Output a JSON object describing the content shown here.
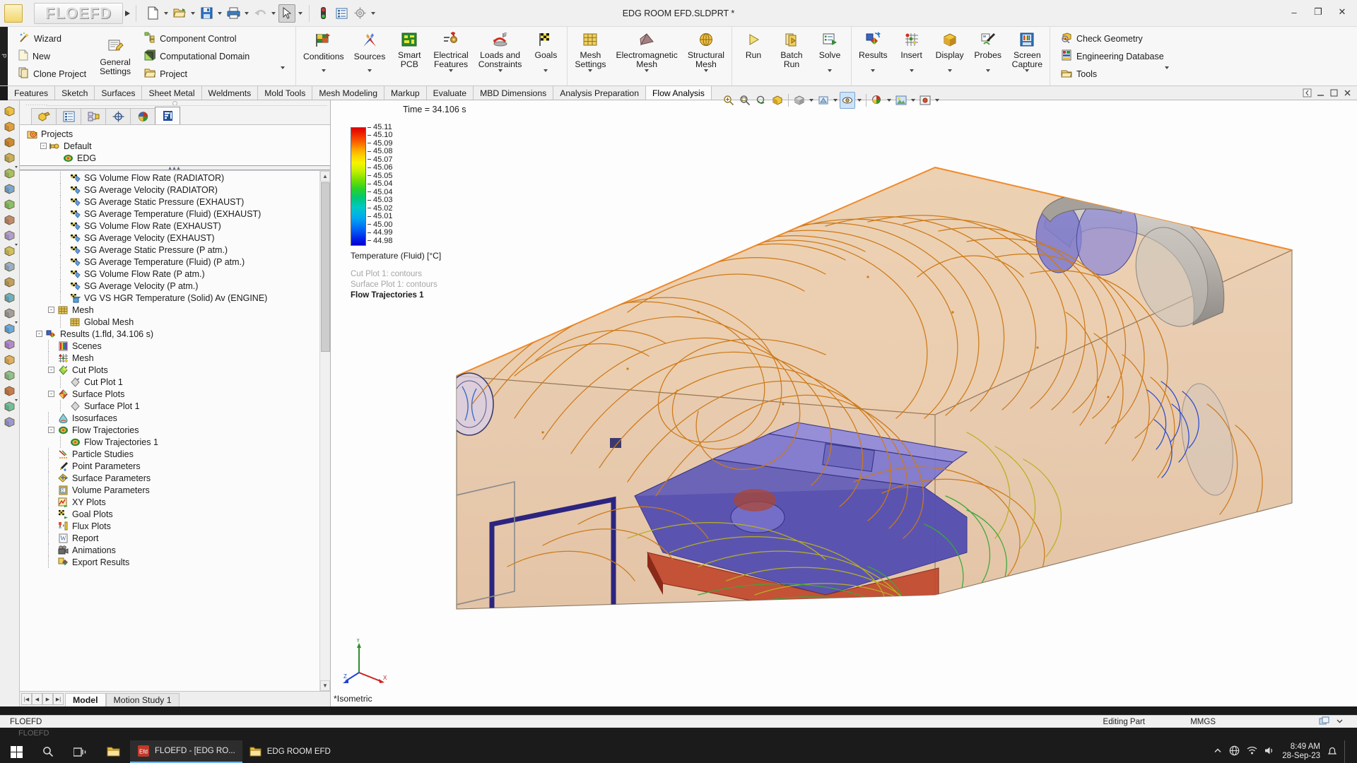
{
  "window": {
    "title": "EDG ROOM EFD.SLDPRT *",
    "app_logo": "FLOEFD",
    "minimize": "–",
    "maximize": "❐",
    "close": "✕",
    "side_strip": "P"
  },
  "quick_access": [
    {
      "name": "new-document-button",
      "icon": "new-doc-icon",
      "dropdown": true
    },
    {
      "name": "open-document-button",
      "icon": "open-folder-icon",
      "dropdown": true
    },
    {
      "name": "save-button",
      "icon": "save-disk-icon",
      "dropdown": true
    },
    {
      "name": "print-button",
      "icon": "printer-icon",
      "dropdown": true
    },
    {
      "name": "undo-button",
      "icon": "undo-arrow-icon",
      "dropdown": true
    },
    {
      "name": "select-tool-button",
      "icon": "cursor-arrow-icon",
      "dropdown": true,
      "active": true
    },
    {
      "name": "rebuild-button",
      "icon": "traffic-light-icon",
      "dropdown": false
    },
    {
      "name": "options-list-button",
      "icon": "list-panel-icon",
      "dropdown": false
    },
    {
      "name": "settings-button",
      "icon": "gear-icon",
      "dropdown": true
    }
  ],
  "ribbon": {
    "group_project": {
      "items": [
        {
          "label": "Wizard",
          "icon": "wand-icon"
        },
        {
          "label": "New",
          "icon": "new-page-icon"
        },
        {
          "label": "Clone Project",
          "icon": "clone-icon"
        }
      ],
      "general_settings": {
        "label": "General\nSettings",
        "icon": "general-settings-icon"
      },
      "col3": [
        {
          "label": "Component Control",
          "icon": "component-control-icon"
        },
        {
          "label": "Computational Domain",
          "icon": "computational-domain-icon"
        },
        {
          "label": "Project",
          "icon": "project-folder-icon",
          "dropdown": true
        }
      ]
    },
    "group_definition": [
      {
        "label": "Conditions",
        "icon": "conditions-flag-icon",
        "dropdown": true
      },
      {
        "label": "Sources",
        "icon": "sources-icon",
        "dropdown": true
      },
      {
        "label": "Smart\nPCB",
        "icon": "smart-pcb-icon",
        "dropdown": false
      },
      {
        "label": "Electrical\nFeatures",
        "icon": "electrical-features-icon",
        "dropdown": true
      },
      {
        "label": "Loads and\nConstraints",
        "icon": "loads-constraints-icon",
        "dropdown": true
      },
      {
        "label": "Goals",
        "icon": "goals-checkered-flag-icon",
        "dropdown": true
      }
    ],
    "group_mesh": [
      {
        "label": "Mesh\nSettings",
        "icon": "mesh-settings-icon",
        "dropdown": true
      },
      {
        "label": "Electromagnetic\nMesh",
        "icon": "electromagnetic-mesh-icon",
        "dropdown": true
      },
      {
        "label": "Structural\nMesh",
        "icon": "structural-mesh-icon",
        "dropdown": true
      }
    ],
    "group_solve": [
      {
        "label": "Run",
        "icon": "run-play-icon",
        "dropdown": false
      },
      {
        "label": "Batch\nRun",
        "icon": "batch-run-icon",
        "dropdown": false
      },
      {
        "label": "Solve",
        "icon": "solve-icon",
        "dropdown": true
      }
    ],
    "group_results": [
      {
        "label": "Results",
        "icon": "results-icon",
        "dropdown": true
      },
      {
        "label": "Insert",
        "icon": "insert-grid-icon",
        "dropdown": true
      },
      {
        "label": "Display",
        "icon": "display-icon",
        "dropdown": true
      },
      {
        "label": "Probes",
        "icon": "probes-icon",
        "dropdown": true
      },
      {
        "label": "Screen\nCapture",
        "icon": "screen-capture-icon",
        "dropdown": true
      }
    ],
    "group_tools": [
      {
        "label": "Check Geometry",
        "icon": "check-geometry-icon"
      },
      {
        "label": "Engineering Database",
        "icon": "engineering-database-icon"
      },
      {
        "label": "Tools",
        "icon": "tools-icon",
        "dropdown": true
      }
    ]
  },
  "tabs": {
    "items": [
      {
        "label": "Features",
        "active": false
      },
      {
        "label": "Sketch",
        "active": false
      },
      {
        "label": "Surfaces",
        "active": false
      },
      {
        "label": "Sheet Metal",
        "active": false
      },
      {
        "label": "Weldments",
        "active": false
      },
      {
        "label": "Mold Tools",
        "active": false
      },
      {
        "label": "Mesh Modeling",
        "active": false
      },
      {
        "label": "Markup",
        "active": false
      },
      {
        "label": "Evaluate",
        "active": false
      },
      {
        "label": "MBD Dimensions",
        "active": false
      },
      {
        "label": "Analysis Preparation",
        "active": false
      },
      {
        "label": "Flow Analysis",
        "active": true
      }
    ]
  },
  "view_toolbar": {
    "buttons": [
      {
        "name": "zoom-to-fit-icon",
        "dropdown": false
      },
      {
        "name": "zoom-area-icon",
        "dropdown": false
      },
      {
        "name": "previous-view-icon",
        "dropdown": false
      },
      {
        "name": "section-view-icon",
        "dropdown": false
      },
      {
        "name": "view-orientation-icon",
        "dropdown": true
      },
      {
        "name": "display-style-icon",
        "dropdown": true
      },
      {
        "name": "hide-show-items-icon",
        "dropdown": true,
        "active": true
      },
      {
        "name": "edit-appearance-icon",
        "dropdown": true
      },
      {
        "name": "apply-scene-icon",
        "dropdown": true
      },
      {
        "name": "view-settings-icon",
        "dropdown": true
      }
    ],
    "right_buttons": [
      {
        "name": "collapse-panel-icon"
      },
      {
        "name": "restore-down-icon"
      },
      {
        "name": "maximize-window-icon"
      },
      {
        "name": "close-document-icon"
      }
    ]
  },
  "left_rail": {
    "icons": [
      "extruded-boss-icon",
      "revolved-boss-icon",
      "swept-boss-icon",
      "lofted-boss-icon",
      "extruded-cut-icon",
      "hole-wizard-icon",
      "revolved-cut-icon",
      "swept-cut-icon",
      "fillet-icon",
      "linear-pattern-icon",
      "rib-icon",
      "draft-icon",
      "shell-icon",
      "mirror-icon",
      "reference-geometry-icon",
      "curves-icon",
      "instant3d-icon",
      "intersect-icon",
      "split-icon",
      "move-face-icon",
      "delete-face-icon"
    ]
  },
  "tree_panel": {
    "tabs": [
      {
        "name": "feature-manager-tab",
        "icon": "feature-tree-icon",
        "active": false
      },
      {
        "name": "property-manager-tab",
        "icon": "property-list-icon",
        "active": false
      },
      {
        "name": "configuration-manager-tab",
        "icon": "configuration-icon",
        "active": false
      },
      {
        "name": "dimxpert-manager-tab",
        "icon": "dimxpert-target-icon",
        "active": false
      },
      {
        "name": "display-manager-tab",
        "icon": "display-sphere-icon",
        "active": false
      },
      {
        "name": "flow-analysis-tree-tab",
        "icon": "floefd-tree-icon",
        "active": true
      }
    ],
    "top_nodes": [
      {
        "label": "Projects",
        "icon": "projects-icon",
        "indent": 0,
        "expander": ""
      },
      {
        "label": "Default",
        "icon": "default-config-icon",
        "indent": 1,
        "expander": "-"
      },
      {
        "label": "EDG",
        "icon": "edg-project-icon",
        "indent": 2,
        "expander": ""
      }
    ],
    "items": [
      {
        "label": "SG Volume Flow Rate (RADIATOR)",
        "icon": "goal-flag-icon",
        "indent": 3,
        "expander": ""
      },
      {
        "label": "SG Average Velocity (RADIATOR)",
        "icon": "goal-flag-icon",
        "indent": 3,
        "expander": ""
      },
      {
        "label": "SG Average Static Pressure (EXHAUST)",
        "icon": "goal-flag-icon",
        "indent": 3,
        "expander": ""
      },
      {
        "label": "SG Average Temperature (Fluid) (EXHAUST)",
        "icon": "goal-flag-icon",
        "indent": 3,
        "expander": ""
      },
      {
        "label": "SG Volume Flow Rate (EXHAUST)",
        "icon": "goal-flag-icon",
        "indent": 3,
        "expander": ""
      },
      {
        "label": "SG Average Velocity (EXHAUST)",
        "icon": "goal-flag-icon",
        "indent": 3,
        "expander": ""
      },
      {
        "label": "SG Average Static Pressure (P atm.)",
        "icon": "goal-flag-icon",
        "indent": 3,
        "expander": ""
      },
      {
        "label": "SG Average Temperature (Fluid) (P atm.)",
        "icon": "goal-flag-icon",
        "indent": 3,
        "expander": ""
      },
      {
        "label": "SG Volume Flow Rate (P atm.)",
        "icon": "goal-flag-icon",
        "indent": 3,
        "expander": ""
      },
      {
        "label": "SG Average Velocity (P atm.)",
        "icon": "goal-flag-icon",
        "indent": 3,
        "expander": ""
      },
      {
        "label": "VG VS HGR Temperature (Solid) Av (ENGINE)",
        "icon": "volume-goal-icon",
        "indent": 3,
        "expander": ""
      },
      {
        "label": "Mesh",
        "icon": "mesh-cube-icon",
        "indent": 2,
        "expander": "-"
      },
      {
        "label": "Global Mesh",
        "icon": "mesh-cube-icon",
        "indent": 3,
        "expander": ""
      },
      {
        "label": "Results (1.fld, 34.106 s)",
        "icon": "results-icon",
        "indent": 1,
        "expander": "-"
      },
      {
        "label": "Scenes",
        "icon": "scenes-icon",
        "indent": 2,
        "expander": ""
      },
      {
        "label": "Mesh",
        "icon": "mesh-grid-icon",
        "indent": 2,
        "expander": ""
      },
      {
        "label": "Cut Plots",
        "icon": "cut-plot-icon",
        "indent": 2,
        "expander": "-"
      },
      {
        "label": "Cut Plot 1",
        "icon": "cut-plot-grey-icon",
        "indent": 3,
        "expander": ""
      },
      {
        "label": "Surface Plots",
        "icon": "surface-plot-icon",
        "indent": 2,
        "expander": "-"
      },
      {
        "label": "Surface Plot 1",
        "icon": "surface-plot-grey-icon",
        "indent": 3,
        "expander": ""
      },
      {
        "label": "Isosurfaces",
        "icon": "isosurface-icon",
        "indent": 2,
        "expander": ""
      },
      {
        "label": "Flow Trajectories",
        "icon": "flow-trajectories-icon",
        "indent": 2,
        "expander": "-"
      },
      {
        "label": "Flow Trajectories 1",
        "icon": "flow-trajectories-icon",
        "indent": 3,
        "expander": ""
      },
      {
        "label": "Particle Studies",
        "icon": "particle-studies-icon",
        "indent": 2,
        "expander": ""
      },
      {
        "label": "Point Parameters",
        "icon": "point-parameters-icon",
        "indent": 2,
        "expander": ""
      },
      {
        "label": "Surface Parameters",
        "icon": "surface-parameters-icon",
        "indent": 2,
        "expander": ""
      },
      {
        "label": "Volume Parameters",
        "icon": "volume-parameters-icon",
        "indent": 2,
        "expander": ""
      },
      {
        "label": "XY Plots",
        "icon": "xy-plots-icon",
        "indent": 2,
        "expander": ""
      },
      {
        "label": "Goal Plots",
        "icon": "goal-plots-icon",
        "indent": 2,
        "expander": ""
      },
      {
        "label": "Flux Plots",
        "icon": "flux-plots-icon",
        "indent": 2,
        "expander": ""
      },
      {
        "label": "Report",
        "icon": "report-word-icon",
        "indent": 2,
        "expander": ""
      },
      {
        "label": "Animations",
        "icon": "animations-camera-icon",
        "indent": 2,
        "expander": ""
      },
      {
        "label": "Export Results",
        "icon": "export-results-icon",
        "indent": 2,
        "expander": ""
      }
    ],
    "bottom_tabs": [
      {
        "label": "Model",
        "active": true
      },
      {
        "label": "Motion Study 1",
        "active": false
      }
    ],
    "nav_buttons": [
      "first-tab-button",
      "previous-tab-button",
      "next-tab-button",
      "last-tab-button"
    ]
  },
  "viewport": {
    "time_label": "Time = 34.106 s",
    "orientation_label": "*Isometric",
    "legend_title": "Temperature (Fluid) [°C]",
    "notes": [
      {
        "text": "Cut Plot 1: contours",
        "style": "grey"
      },
      {
        "text": "Surface Plot 1: contours",
        "style": "grey"
      },
      {
        "text": "Flow Trajectories 1",
        "style": "bold"
      }
    ],
    "triad_axes": [
      {
        "label": "Y",
        "color": "#2f8f2f"
      },
      {
        "label": "X",
        "color": "#cc2222"
      },
      {
        "label": "Z",
        "color": "#2244cc"
      }
    ]
  },
  "chart_data": {
    "type": "heatmap",
    "title": "Temperature (Fluid) [°C]",
    "ylabel": "Temperature (Fluid) [°C]",
    "unit": "°C",
    "tick_labels": [
      "45.11",
      "45.10",
      "45.09",
      "45.08",
      "45.07",
      "45.06",
      "45.05",
      "45.04",
      "45.04",
      "45.03",
      "45.02",
      "45.01",
      "45.00",
      "44.99",
      "44.98"
    ],
    "values": [
      45.11,
      45.1,
      45.09,
      45.08,
      45.07,
      45.06,
      45.05,
      45.04,
      45.04,
      45.03,
      45.02,
      45.01,
      45.0,
      44.99,
      44.98
    ],
    "ylim": [
      44.98,
      45.11
    ],
    "colors": [
      "#e00000",
      "#f45500",
      "#ff9100",
      "#ffc800",
      "#f2f200",
      "#b8ee00",
      "#6ddc00",
      "#22cd33",
      "#00c884",
      "#00c8c8",
      "#00a6f2",
      "#0066f5",
      "#0030ea",
      "#0010d8",
      "#0000d2"
    ],
    "legend_position": "left"
  },
  "status_bar": {
    "left": "FLOEFD",
    "mode": "Editing Part",
    "units": "MMGS",
    "icons": [
      "overlay-icon",
      "expand-status-icon"
    ]
  },
  "lower_strip": {
    "label": "FLOEFD"
  },
  "taskbar": {
    "start": "start-windows-icon",
    "search": "search-icon",
    "task_view": "task-view-icon",
    "pinned": [
      {
        "name": "file-explorer-icon",
        "label": ""
      }
    ],
    "items": [
      {
        "label": "FLOEFD - [EDG RO...",
        "icon": "floefd-app-icon",
        "running": true
      },
      {
        "label": "EDG ROOM EFD",
        "icon": "folder-icon",
        "running": false
      }
    ],
    "tray": [
      "show-hidden-icons-chevron",
      "network-icon",
      "globe-icon",
      "volume-icon"
    ],
    "clock_time": "8:49 AM",
    "clock_date": "28-Sep-23",
    "notification": "notification-icon"
  }
}
